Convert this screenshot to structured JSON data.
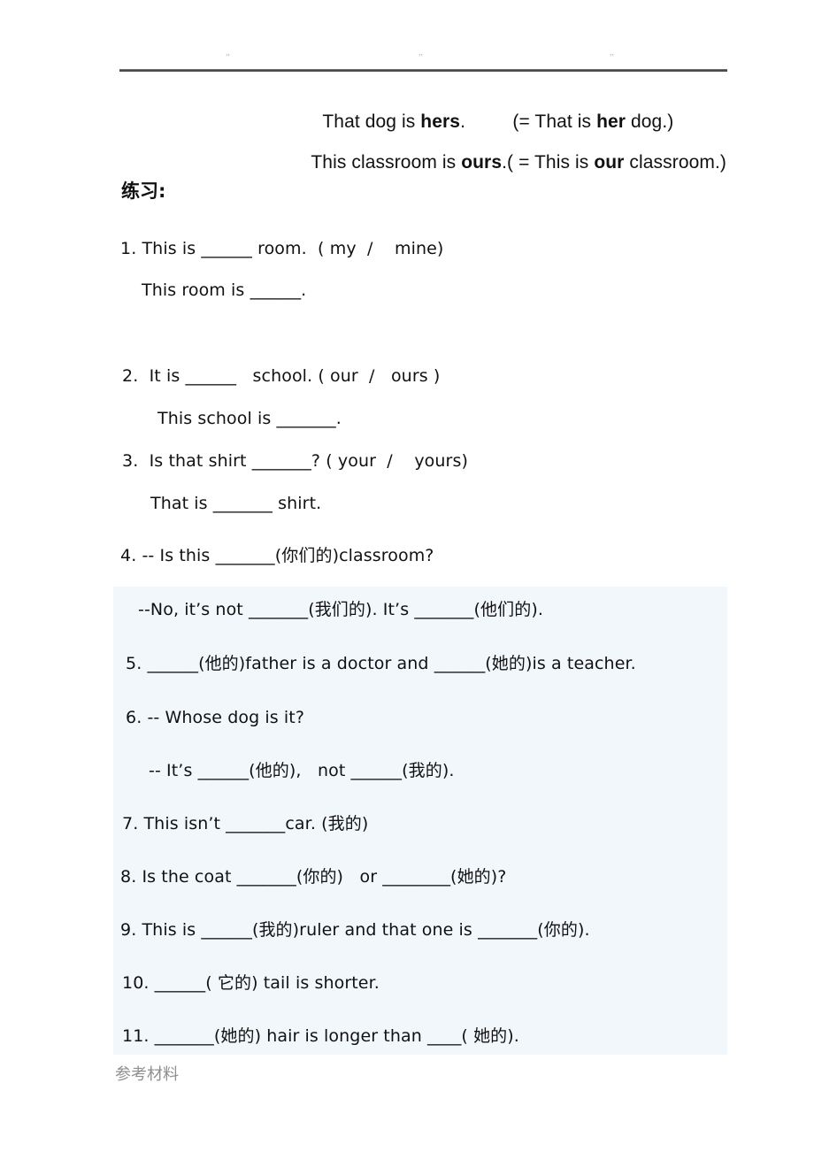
{
  "header": {
    "quote_marks": [
      "”",
      "”",
      "”"
    ]
  },
  "examples": [
    {
      "id": "example-hers",
      "segments": [
        "That dog is ",
        "hers",
        ".         (= That is ",
        "her",
        " dog.)"
      ],
      "plain": "That dog is hers.         (= That is her dog.)"
    },
    {
      "id": "example-ours",
      "segments": [
        "This classroom is ",
        "ours",
        ".( = This is ",
        "our",
        " classroom.)"
      ],
      "plain": "This classroom is ours.( = This is our classroom.)"
    }
  ],
  "section": {
    "label": "练习:"
  },
  "exercises": [
    {
      "id": "q1a",
      "text": "1. This is ______ room.  ( my  /    mine)"
    },
    {
      "id": "q1b",
      "text": "This room is ______."
    },
    {
      "id": "q2a",
      "text": "2.  It is ______   school. ( our  /   ours )"
    },
    {
      "id": "q2b",
      "text": "This school is _______."
    },
    {
      "id": "q3a",
      "text": "3.  Is that shirt _______? ( your  /    yours)"
    },
    {
      "id": "q3b",
      "text": "That is _______ shirt."
    },
    {
      "id": "q4a",
      "text": "4. -- Is this _______(你们的)classroom?"
    },
    {
      "id": "q4b",
      "text": "--No, it’s not _______(我们的). It’s _______(他们的)."
    },
    {
      "id": "q5",
      "text": "5. ______(他的)father is a doctor and ______(她的)is a teacher."
    },
    {
      "id": "q6a",
      "text": "6. -- Whose dog is it?"
    },
    {
      "id": "q6b",
      "text": "-- It’s ______(他的),   not ______(我的)."
    },
    {
      "id": "q7",
      "text": "7. This isn’t _______car. (我的)"
    },
    {
      "id": "q8",
      "text": "8. Is the coat _______(你的)   or ________(她的)?"
    },
    {
      "id": "q9",
      "text": "9. This is ______(我的)ruler and that one is _______(你的)."
    },
    {
      "id": "q10",
      "text": "10. ______( 它的) tail is shorter."
    },
    {
      "id": "q11",
      "text": "11. _______(她的) hair is longer than ____( 她的)."
    }
  ],
  "watermark": {
    "text": "参考材料"
  },
  "colors": {
    "page_background": "#ffffff",
    "text": "#111111",
    "highlight_band": "#f2f7fc",
    "rule": "#4a4a4a",
    "watermark": "#8f8f8f",
    "faint_mark": "#b9b9b9"
  }
}
